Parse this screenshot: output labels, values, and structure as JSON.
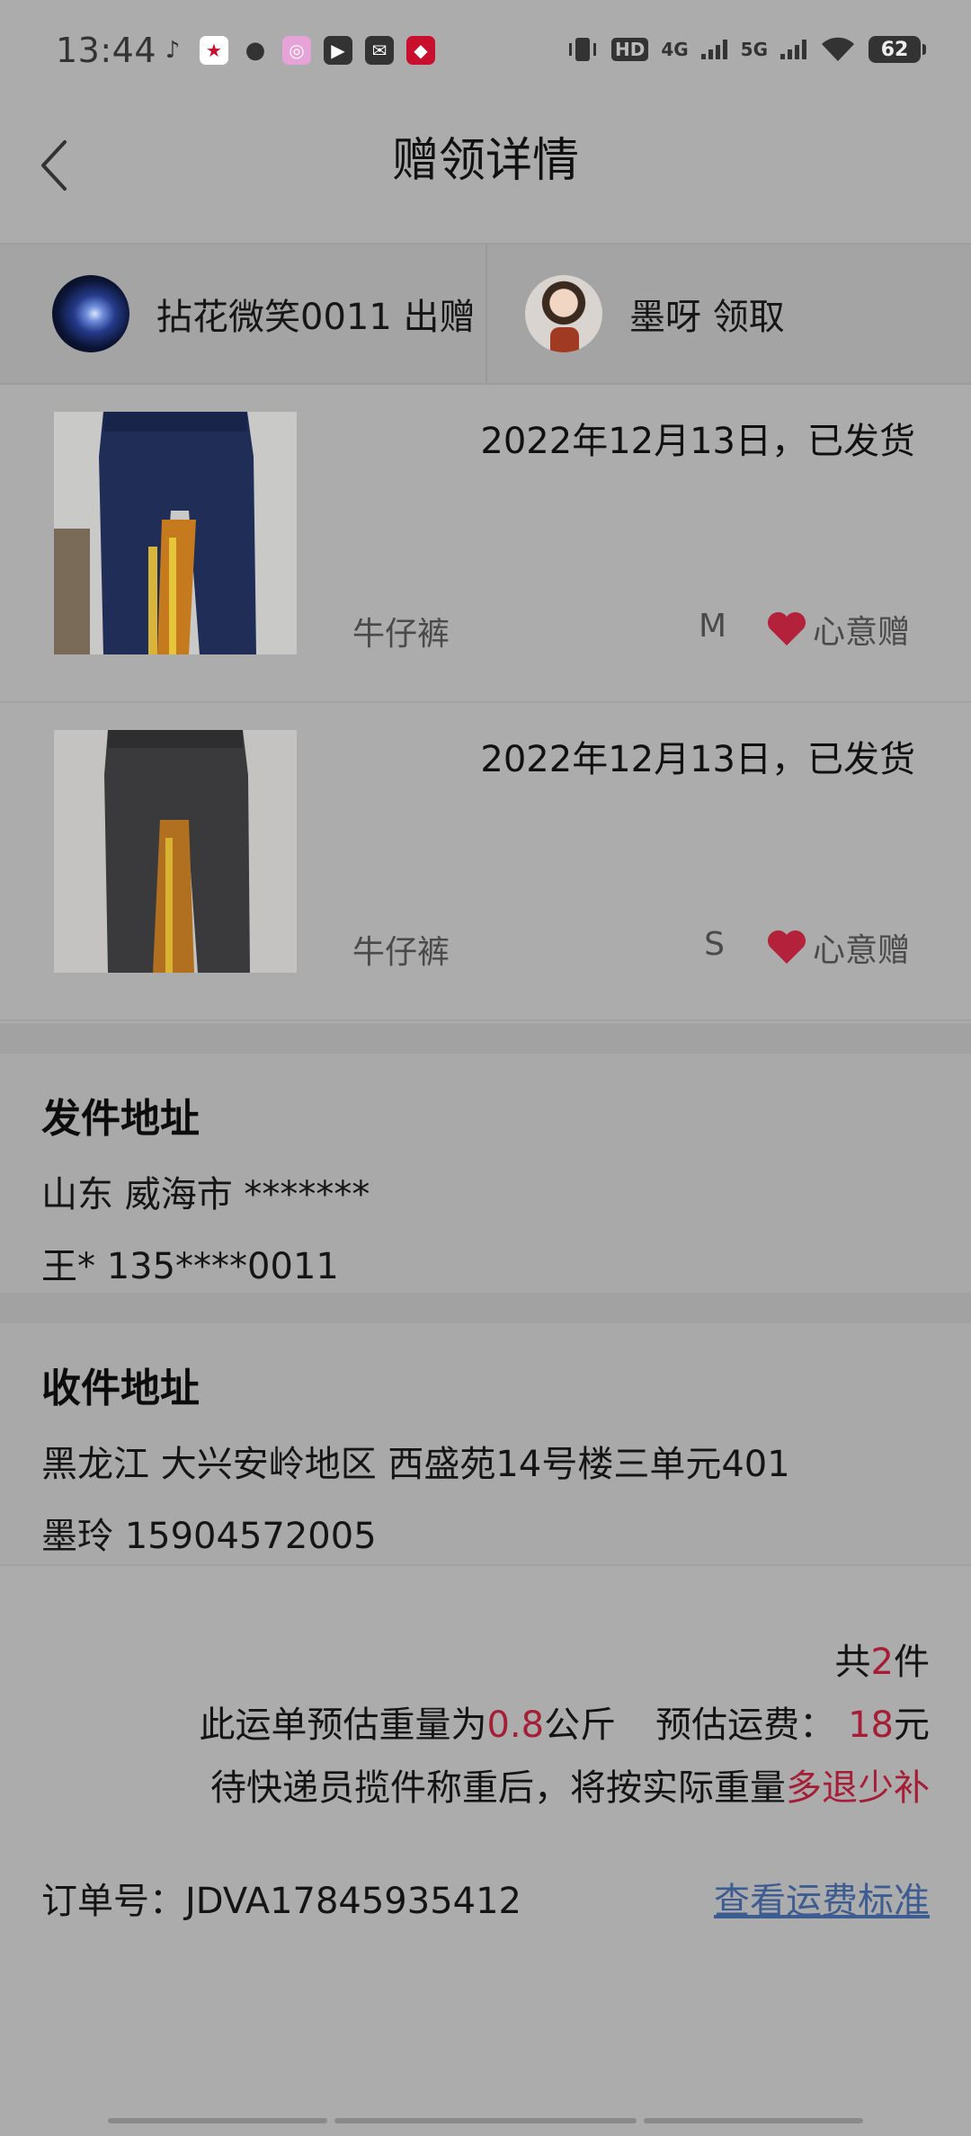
{
  "status_bar": {
    "time": "13:44",
    "network_hd": "HD",
    "network_4g": "4G",
    "network_5g": "5G",
    "battery": "62"
  },
  "nav": {
    "title": "赠领详情"
  },
  "parties": {
    "giver": "拈花微笑0011 出赠",
    "receiver": "墨呀 领取"
  },
  "items": [
    {
      "status": "2022年12月13日，已发货",
      "name": "牛仔裤",
      "size": "M",
      "tag": "心意赠",
      "image": "dark-blue-jeans-photo"
    },
    {
      "status": "2022年12月13日，已发货",
      "name": "牛仔裤",
      "size": "S",
      "tag": "心意赠",
      "image": "grey-jeans-photo"
    }
  ],
  "sender_address": {
    "title": "发件地址",
    "line1": "山东 威海市 *******",
    "line2": "王* 135****0011"
  },
  "receiver_address": {
    "title": "收件地址",
    "line1": "黑龙江 大兴安岭地区 西盛苑14号楼三单元401",
    "line2": "墨玲 15904572005"
  },
  "summary": {
    "count_prefix": "共",
    "count": "2",
    "count_suffix": "件",
    "weight_prefix": "此运单预估重量为",
    "weight": "0.8",
    "weight_unit": "公斤",
    "fee_label": "预估运费：",
    "fee": "18",
    "fee_unit": "元",
    "note_prefix": "待快递员揽件称重后，将按实际重量",
    "note_highlight": "多退少补",
    "order_label": "订单号：",
    "order_no": "JDVA17845935412",
    "fee_standard_link": "查看运费标准"
  },
  "colors": {
    "accent_red": "#a51e36",
    "link_blue": "#3d5c91",
    "background": "#acacac"
  }
}
